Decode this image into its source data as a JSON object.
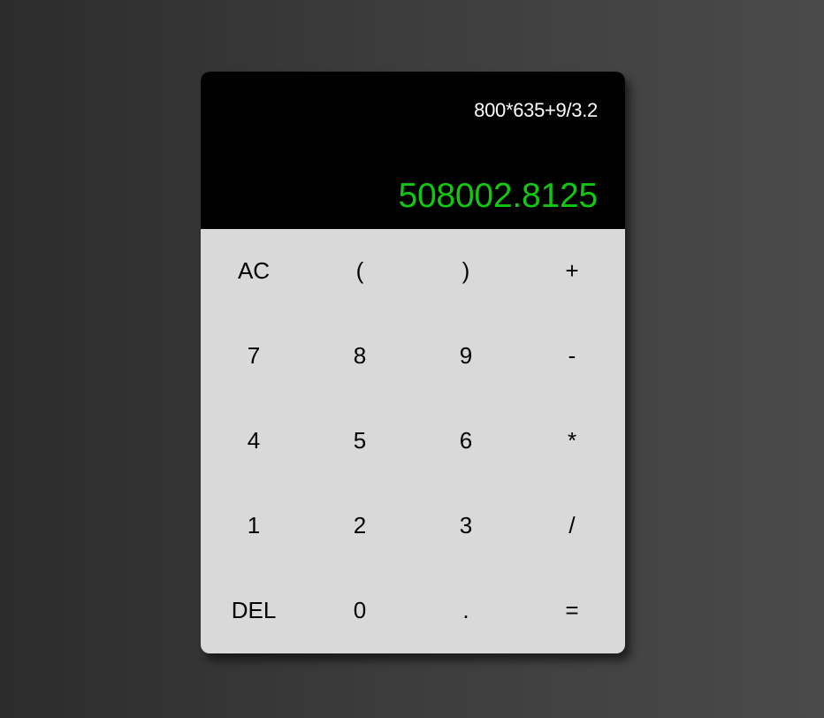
{
  "display": {
    "expression": "800*635+9/3.2",
    "result": "508002.8125",
    "result_color": "#11c711"
  },
  "keys": [
    {
      "label": "AC",
      "name": "clear-all-button"
    },
    {
      "label": "(",
      "name": "open-paren-button"
    },
    {
      "label": ")",
      "name": "close-paren-button"
    },
    {
      "label": "+",
      "name": "add-button"
    },
    {
      "label": "7",
      "name": "digit-7-button"
    },
    {
      "label": "8",
      "name": "digit-8-button"
    },
    {
      "label": "9",
      "name": "digit-9-button"
    },
    {
      "label": "-",
      "name": "subtract-button"
    },
    {
      "label": "4",
      "name": "digit-4-button"
    },
    {
      "label": "5",
      "name": "digit-5-button"
    },
    {
      "label": "6",
      "name": "digit-6-button"
    },
    {
      "label": "*",
      "name": "multiply-button"
    },
    {
      "label": "1",
      "name": "digit-1-button"
    },
    {
      "label": "2",
      "name": "digit-2-button"
    },
    {
      "label": "3",
      "name": "digit-3-button"
    },
    {
      "label": "/",
      "name": "divide-button"
    },
    {
      "label": "DEL",
      "name": "delete-button"
    },
    {
      "label": "0",
      "name": "digit-0-button"
    },
    {
      "label": ".",
      "name": "decimal-point-button"
    },
    {
      "label": "=",
      "name": "equals-button"
    }
  ]
}
